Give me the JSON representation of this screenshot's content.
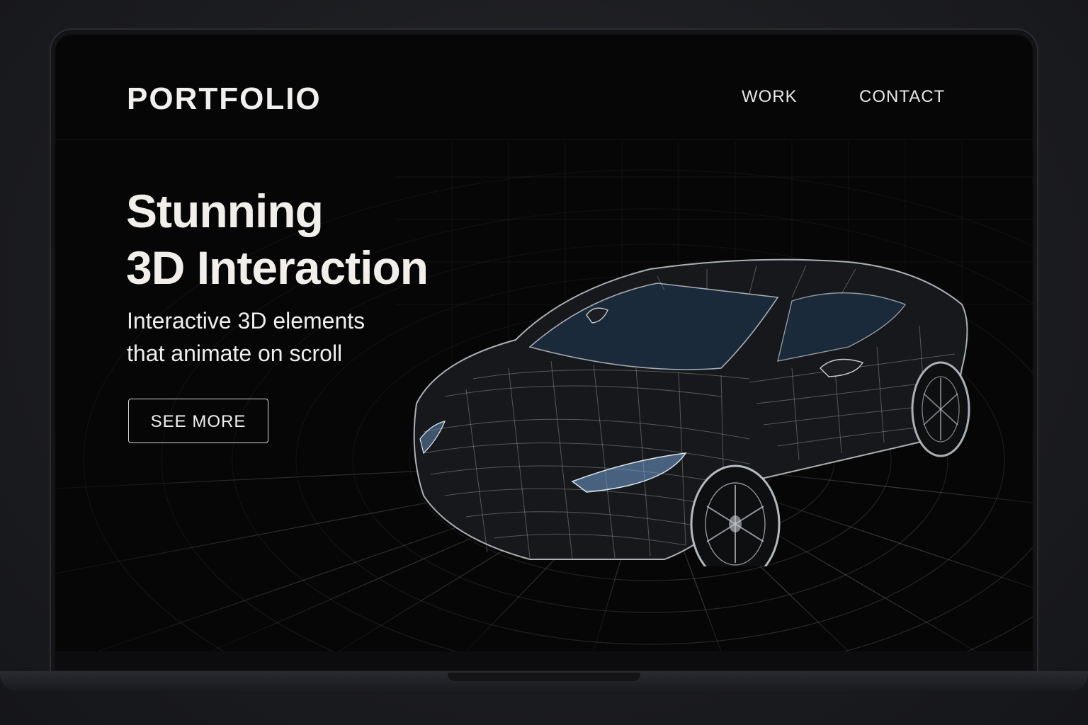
{
  "header": {
    "logo": "PORTFOLIO",
    "nav": [
      {
        "label": "WORK"
      },
      {
        "label": "CONTACT"
      }
    ]
  },
  "hero": {
    "title_line1": "Stunning",
    "title_line2": "3D Interaction",
    "subtitle_line1": "Interactive 3D elements",
    "subtitle_line2": "that animate on scroll",
    "cta_label": "SEE MORE"
  },
  "illustration": {
    "subject": "wireframe-sports-car",
    "floor": "polar-grid",
    "colors": {
      "background": "#060607",
      "wire": "#c8ccd2",
      "glass": "#1a2a3a",
      "headlight": "#6f9ecf",
      "text": "#f2eeea"
    }
  }
}
